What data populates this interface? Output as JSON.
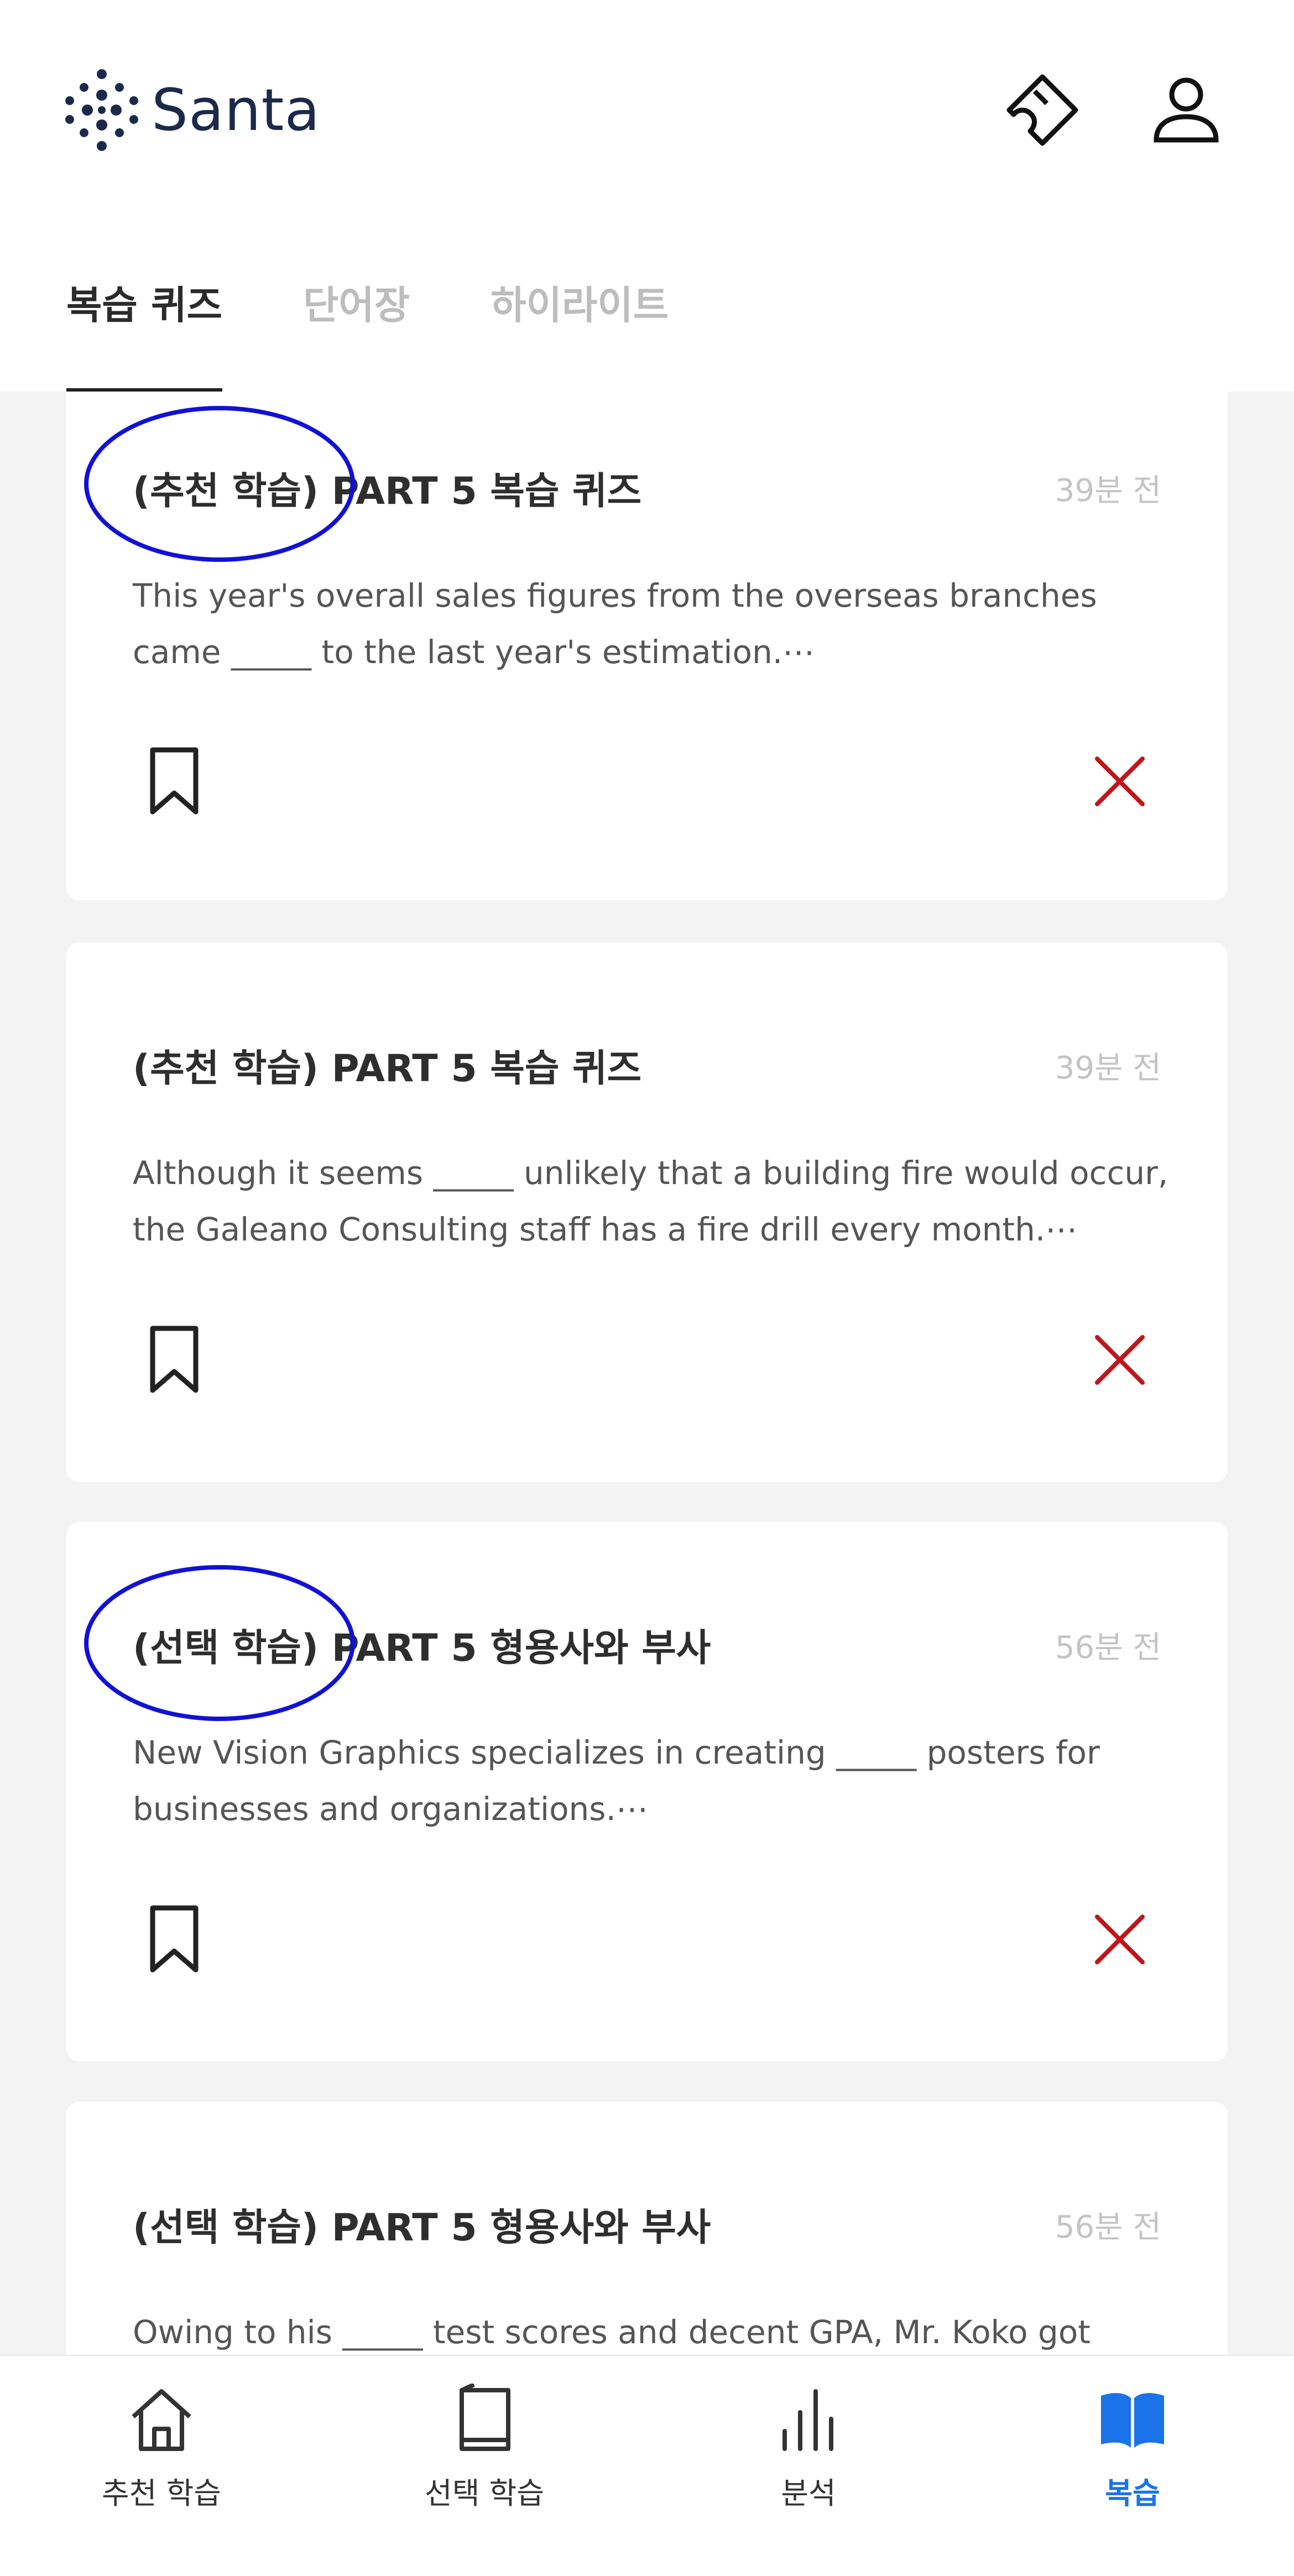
{
  "app": {
    "logo_text": "Santa"
  },
  "header": {
    "icons": [
      "ticket-icon",
      "profile-icon"
    ]
  },
  "tabs": [
    {
      "label": "복습 퀴즈",
      "active": true
    },
    {
      "label": "단어장",
      "active": false
    },
    {
      "label": "하이라이트",
      "active": false
    }
  ],
  "cards": [
    {
      "title": "(추천 학습) PART 5 복습 퀴즈",
      "time": "39분 전",
      "text": "This year's overall sales figures from the overseas branches came _____ to the last year's estimation.⋯"
    },
    {
      "title": "(추천 학습) PART 5 복습 퀴즈",
      "time": "39분 전",
      "text": "Although it seems _____ unlikely that a building fire would occur, the Galeano Consulting staff has a fire drill every month.⋯"
    },
    {
      "title": "(선택 학습) PART 5 형용사와 부사",
      "time": "56분 전",
      "text": "New Vision Graphics specializes in creating _____ posters for businesses and organizations.⋯"
    },
    {
      "title": "(선택 학습) PART 5 형용사와 부사",
      "time": "56분 전",
      "text": "Owing to his _____ test scores and decent GPA, Mr. Koko got accepted"
    }
  ],
  "bottom_nav": [
    {
      "label": "추천 학습",
      "icon": "home-icon",
      "active": false
    },
    {
      "label": "선택 학습",
      "icon": "book-page-icon",
      "active": false
    },
    {
      "label": "분석",
      "icon": "bar-chart-icon",
      "active": false
    },
    {
      "label": "복습",
      "icon": "open-book-icon",
      "active": true
    }
  ],
  "colors": {
    "accent": "#1a73e8",
    "delete": "#c0161b",
    "annotation_circle": "#1111d6",
    "background": "#f3f3f3"
  }
}
